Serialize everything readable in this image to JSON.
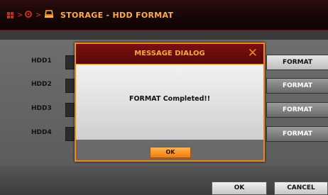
{
  "header": {
    "breadcrumb_sep1": ">",
    "breadcrumb_sep2": ">",
    "title": "STORAGE - HDD FORMAT"
  },
  "drives": [
    {
      "label": "HDD1",
      "button": "FORMAT"
    },
    {
      "label": "HDD2",
      "button": "FORMAT"
    },
    {
      "label": "HDD3",
      "button": "FORMAT"
    },
    {
      "label": "HDD4",
      "button": "FORMAT"
    }
  ],
  "footer": {
    "ok_label": "OK",
    "cancel_label": "CANCEL"
  },
  "dialog": {
    "title": "MESSAGE DIALOG",
    "close_glyph": "✕",
    "message": "FORMAT Completed!!",
    "ok_label": "OK"
  },
  "colors": {
    "accent": "#f08a10",
    "title_red": "#7d1010"
  }
}
